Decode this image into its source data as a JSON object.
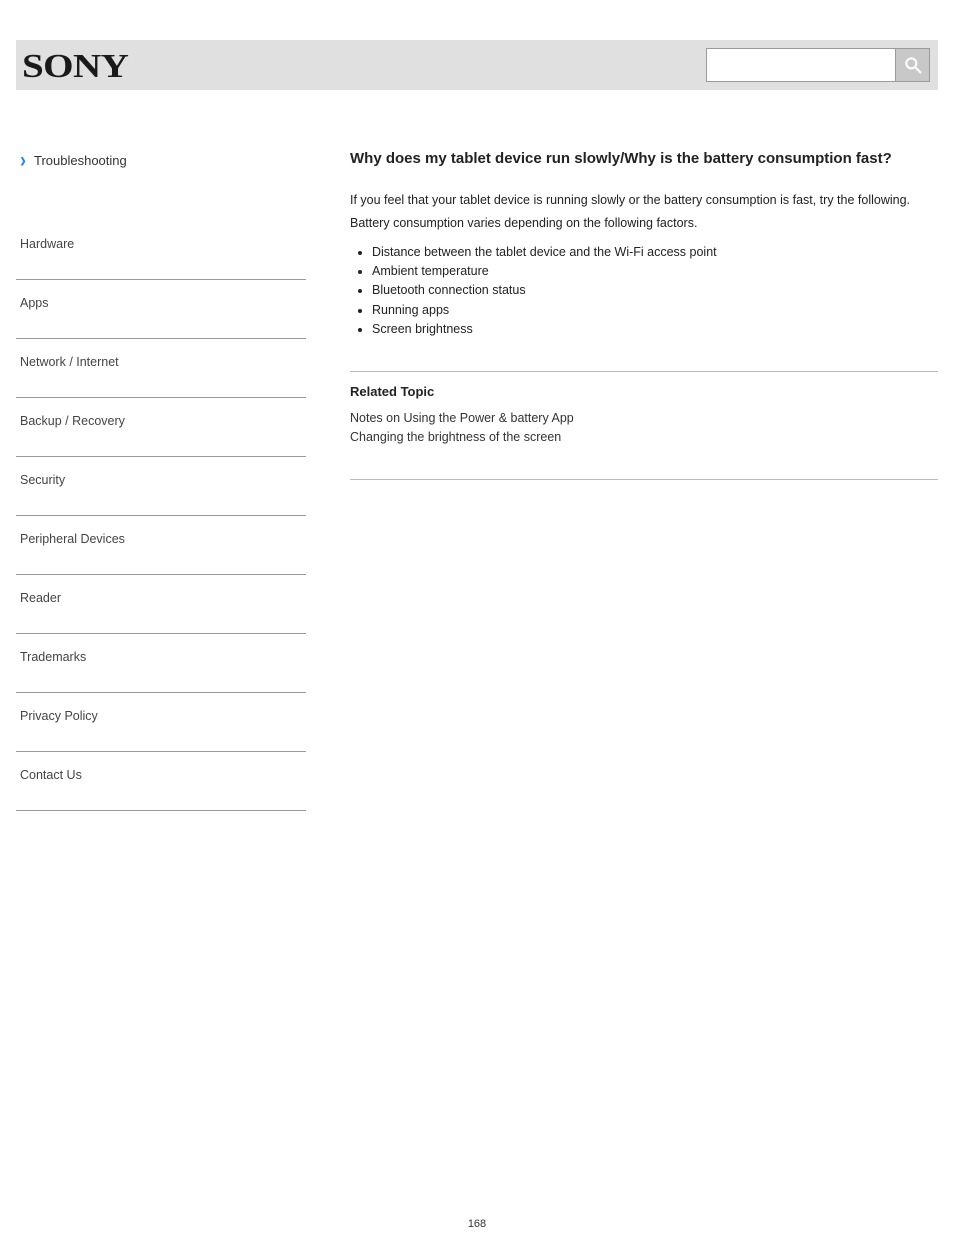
{
  "header": {
    "brand": "SONY",
    "search_placeholder": ""
  },
  "breadcrumb": {
    "label": "Troubleshooting"
  },
  "sidebar": {
    "items": [
      {
        "label": "Hardware"
      },
      {
        "label": "Apps"
      },
      {
        "label": "Network / Internet"
      },
      {
        "label": "Backup / Recovery"
      },
      {
        "label": "Security"
      },
      {
        "label": "Peripheral Devices"
      },
      {
        "label": "Reader"
      },
      {
        "label": "Trademarks"
      },
      {
        "label": "Privacy Policy"
      },
      {
        "label": "Contact Us"
      }
    ]
  },
  "main": {
    "title": "Why does my tablet device run slowly/Why is the battery consumption fast?",
    "lead": "If you feel that your tablet device is running slowly or the battery consumption is fast, try the following.",
    "sub": "Battery consumption varies depending on the following factors.",
    "factors": [
      "Distance between the tablet device and the Wi-Fi access point",
      "Ambient temperature",
      "Bluetooth connection status",
      "Running apps",
      "Screen brightness"
    ],
    "related_title": "Related Topic",
    "related": [
      "Notes on Using the Power & battery App",
      "Changing the brightness of the screen"
    ]
  },
  "page_number": "168"
}
